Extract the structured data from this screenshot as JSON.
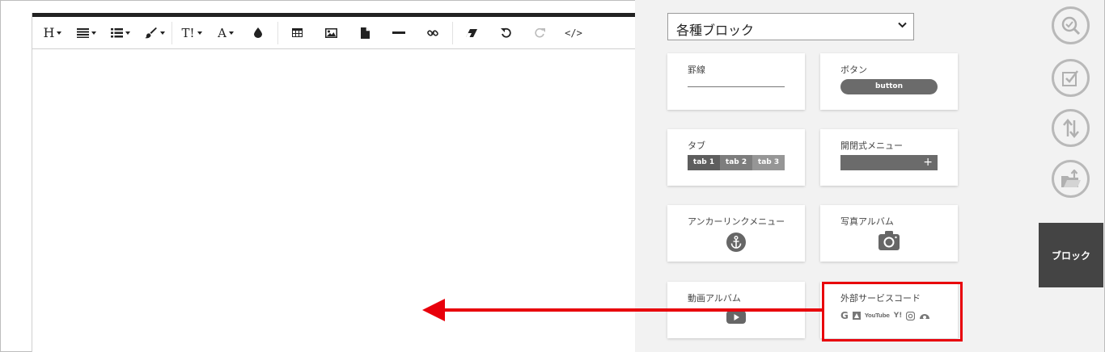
{
  "toolbar": {
    "heading_label": "H",
    "font_size_label": "T!",
    "font_color_label": "A",
    "source_label": "</>"
  },
  "panel": {
    "category_select": {
      "value": "各種ブロック"
    },
    "blocks": [
      {
        "title": "罫線"
      },
      {
        "title": "ボタン",
        "button_label": "button"
      },
      {
        "title": "タブ",
        "tabs": [
          "tab 1",
          "tab 2",
          "tab 3"
        ]
      },
      {
        "title": "開閉式メニュー",
        "plus": "+"
      },
      {
        "title": "アンカーリンクメニュー"
      },
      {
        "title": "写真アルバム"
      },
      {
        "title": "動画アルバム"
      },
      {
        "title": "外部サービスコード",
        "services": [
          "G",
          "YouTube",
          "Y!"
        ]
      }
    ]
  },
  "side": {
    "block_button_label": "ブロック",
    "icons": [
      "search-check-icon",
      "checkbox-icon",
      "sort-icon",
      "folder-upload-icon"
    ]
  },
  "colors": {
    "highlight": "#e8000b",
    "arrow": "#e8000b",
    "block_button_bg": "#444444",
    "panel_bg": "#f2f2f2"
  }
}
